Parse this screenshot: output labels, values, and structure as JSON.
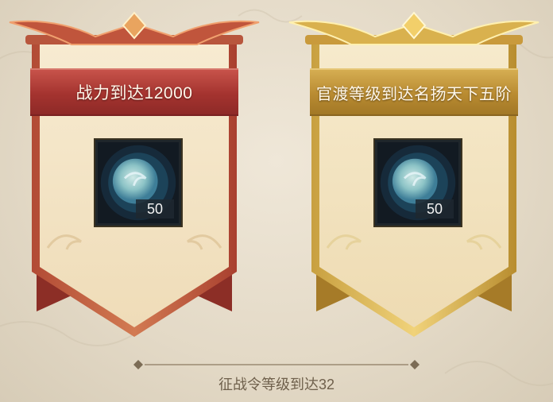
{
  "rewards": [
    {
      "condition": "战力到达12000",
      "theme": "red",
      "accent_color": "#a4332f",
      "item": {
        "icon": "spirit-orb-icon",
        "quantity": "50"
      }
    },
    {
      "condition": "官渡等级到达名扬天下五阶",
      "theme": "gold",
      "accent_color": "#b98b31",
      "item": {
        "icon": "spirit-orb-icon",
        "quantity": "50"
      }
    }
  ],
  "footer": {
    "label": "征战令等级到达32"
  }
}
